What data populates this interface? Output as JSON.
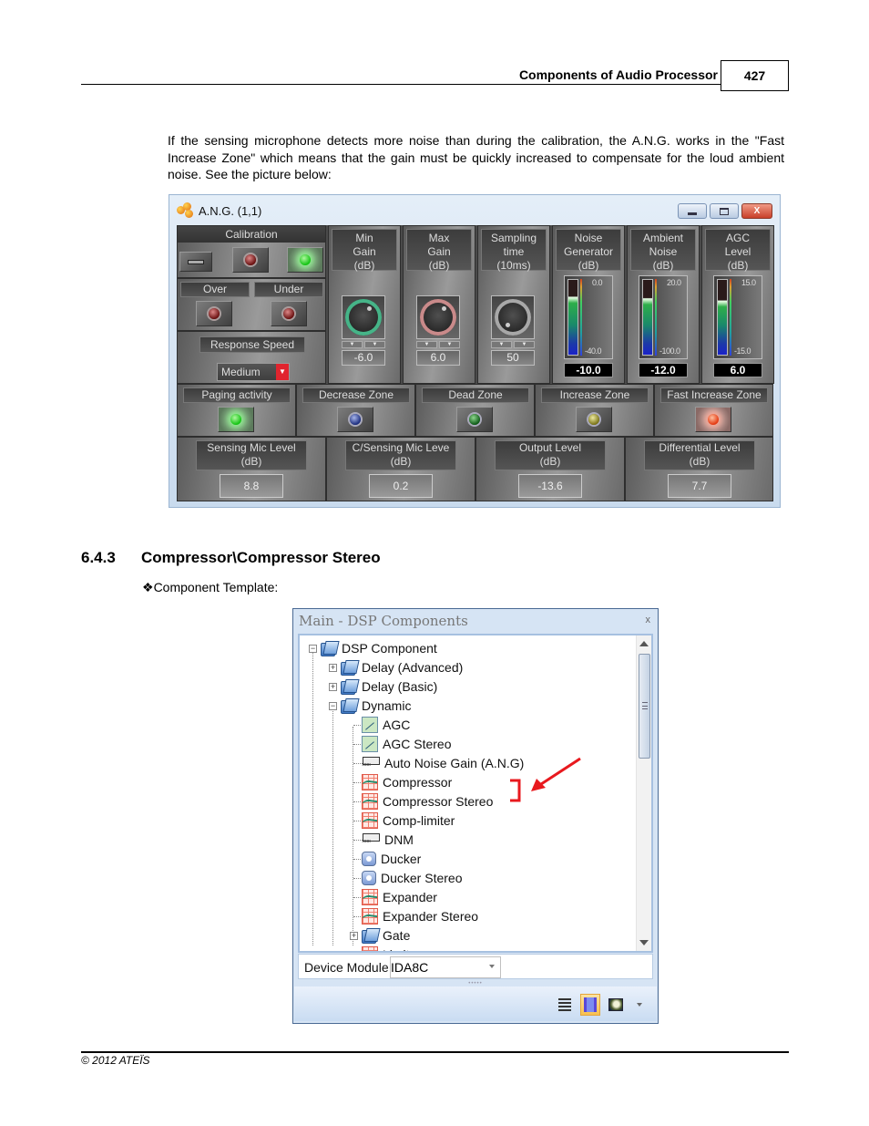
{
  "header": {
    "chapter_title": "Components of Audio Processor",
    "page_number": "427"
  },
  "intro_paragraph": "If the sensing microphone detects more noise than during the calibration, the A.N.G. works in the \"Fast Increase Zone\" which means that the gain must be quickly increased to compensate for the loud ambient noise. See the picture below:",
  "ang_window": {
    "title": "A.N.G. (1,1)",
    "window_buttons": {
      "minimize": "minimize",
      "maximize": "maximize",
      "close": "X"
    },
    "calibration": {
      "label": "Calibration",
      "over_label": "Over",
      "under_label": "Under",
      "response_speed_label": "Response Speed",
      "response_speed_value": "Medium"
    },
    "knobs": [
      {
        "label": "Min\nGain\n(dB)",
        "value": "-6.0",
        "ring": "green"
      },
      {
        "label": "Max\nGain\n(dB)",
        "value": "6.0",
        "ring": "pink"
      },
      {
        "label": "Sampling\ntime\n(10ms)",
        "value": "50",
        "ring": "grey"
      }
    ],
    "meters": [
      {
        "label": "Noise\nGenerator\n(dB)",
        "max": "0.0",
        "min": "-40.0",
        "value": "-10.0",
        "level": 0.75
      },
      {
        "label": "Ambient\nNoise\n(dB)",
        "max": "20.0",
        "min": "-100.0",
        "value": "-12.0",
        "level": 0.73
      },
      {
        "label": "AGC\nLevel\n(dB)",
        "max": "15.0",
        "min": "-15.0",
        "value": "6.0",
        "level": 0.7
      }
    ],
    "zones": [
      {
        "label": "Paging activity",
        "led": "green-on"
      },
      {
        "label": "Decrease Zone",
        "led": "blue"
      },
      {
        "label": "Dead Zone",
        "led": "green"
      },
      {
        "label": "Increase Zone",
        "led": "yellow"
      },
      {
        "label": "Fast Increase Zone",
        "led": "orange-on"
      }
    ],
    "levels": [
      {
        "label": "Sensing Mic Level\n(dB)",
        "value": "8.8"
      },
      {
        "label": "C/Sensing Mic Leve\n(dB)",
        "value": "0.2"
      },
      {
        "label": "Output Level\n(dB)",
        "value": "-13.6"
      },
      {
        "label": "Differential Level\n(dB)",
        "value": "7.7"
      }
    ]
  },
  "section": {
    "number": "6.4.3",
    "title": "Compressor\\Compressor Stereo",
    "bullet_symbol": "❖",
    "bullet_text": "Component Template:"
  },
  "dsp_window": {
    "title": "Main - DSP Components",
    "close_glyph": "x",
    "tree": [
      {
        "label": "DSP Component",
        "icon": "folder-open-icon",
        "level": 0,
        "expander": "−"
      },
      {
        "label": "Delay (Advanced)",
        "icon": "folder-icon",
        "level": 1,
        "expander": "+"
      },
      {
        "label": "Delay (Basic)",
        "icon": "folder-icon",
        "level": 1,
        "expander": "+"
      },
      {
        "label": "Dynamic",
        "icon": "folder-open-icon",
        "level": 1,
        "expander": "−"
      },
      {
        "label": "AGC",
        "icon": "agc-icon",
        "level": 2
      },
      {
        "label": "AGC Stereo",
        "icon": "agc-icon",
        "level": 2
      },
      {
        "label": "Auto Noise Gain (A.N.G)",
        "icon": "ang-icon",
        "level": 2
      },
      {
        "label": "Compressor",
        "icon": "compressor-icon",
        "level": 2
      },
      {
        "label": "Compressor Stereo",
        "icon": "compressor-icon",
        "level": 2
      },
      {
        "label": "Comp-limiter",
        "icon": "compressor-icon",
        "level": 2
      },
      {
        "label": "DNM",
        "icon": "ang-icon",
        "level": 2
      },
      {
        "label": "Ducker",
        "icon": "ducker-icon",
        "level": 2
      },
      {
        "label": "Ducker Stereo",
        "icon": "ducker-icon",
        "level": 2
      },
      {
        "label": "Expander",
        "icon": "compressor-icon",
        "level": 2
      },
      {
        "label": "Expander Stereo",
        "icon": "compressor-icon",
        "level": 2
      },
      {
        "label": "Gate",
        "icon": "folder-icon",
        "level": 2,
        "expander": "+"
      },
      {
        "label": "Limiter",
        "icon": "compressor-icon",
        "level": 2
      }
    ],
    "device_module_label": "Device Module",
    "device_module_value": "IDA8C",
    "grip": "•••••",
    "toolbar": [
      "list-view-icon",
      "component-view-icon",
      "image-view-icon"
    ]
  },
  "annotation": {
    "color": "#e8191e"
  },
  "footer": {
    "copyright": "© 2012 ATEÏS"
  }
}
